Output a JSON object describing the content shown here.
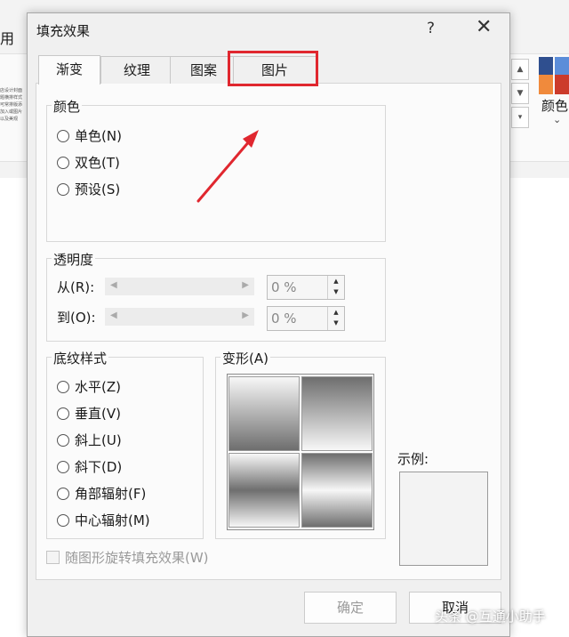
{
  "background": {
    "partial_menu_char": "用",
    "thumb_text": "店设计封面题横排样式可常排版添加入或图片以及美观",
    "color_menu_label": "颜色",
    "swatch_colors": [
      "#2f4f8f",
      "#5b8dd9",
      "#f08a3c",
      "#cc3b2b"
    ]
  },
  "dialog": {
    "title": "填充效果",
    "help_glyph": "?",
    "close_glyph": "✕",
    "tabs": [
      {
        "label": "渐变",
        "active": true
      },
      {
        "label": "纹理",
        "active": false
      },
      {
        "label": "图案",
        "active": false
      },
      {
        "label": "图片",
        "active": false
      }
    ],
    "colors_group": {
      "legend": "颜色",
      "options": [
        {
          "label": "单色(N)"
        },
        {
          "label": "双色(T)"
        },
        {
          "label": "预设(S)"
        }
      ]
    },
    "transparency_group": {
      "legend": "透明度",
      "from_label": "从(R):",
      "to_label": "到(O):",
      "from_value": "0 %",
      "to_value": "0 %"
    },
    "shading_group": {
      "legend": "底纹样式",
      "options": [
        {
          "label": "水平(Z)"
        },
        {
          "label": "垂直(V)"
        },
        {
          "label": "斜上(U)"
        },
        {
          "label": "斜下(D)"
        },
        {
          "label": "角部辐射(F)"
        },
        {
          "label": "中心辐射(M)"
        }
      ]
    },
    "variants_group": {
      "legend": "变形(A)"
    },
    "sample_label": "示例:",
    "rotate_checkbox_label": "随图形旋转填充效果(W)",
    "ok_label": "确定",
    "cancel_label": "取消"
  },
  "annotation": {
    "color": "#e0272f"
  },
  "watermark": "头条 @互通小助手"
}
